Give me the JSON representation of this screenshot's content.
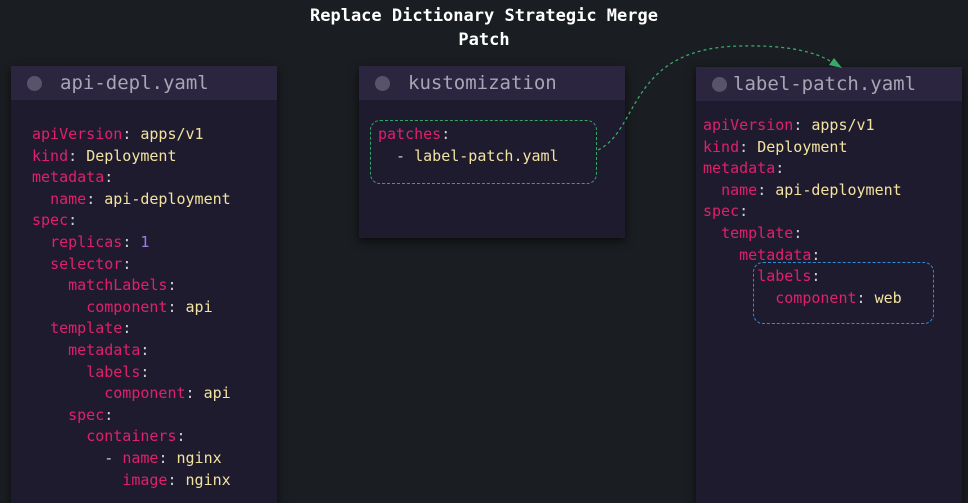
{
  "title_line1": "Replace Dictionary Strategic Merge",
  "title_line2": "Patch",
  "panels": {
    "base": {
      "name": "api-depl.yaml",
      "lines": [
        {
          "indent": "",
          "key": "apiVersion",
          "sep": ": ",
          "value": "apps/v1",
          "vtype": "str"
        },
        {
          "indent": "",
          "key": "kind",
          "sep": ": ",
          "value": "Deployment",
          "vtype": "str"
        },
        {
          "indent": "",
          "key": "metadata",
          "sep": ":",
          "value": "",
          "vtype": "str"
        },
        {
          "indent": "  ",
          "key": "name",
          "sep": ": ",
          "value": "api-deployment",
          "vtype": "str"
        },
        {
          "indent": "",
          "key": "spec",
          "sep": ":",
          "value": "",
          "vtype": "str"
        },
        {
          "indent": "  ",
          "key": "replicas",
          "sep": ": ",
          "value": "1",
          "vtype": "num"
        },
        {
          "indent": "  ",
          "key": "selector",
          "sep": ":",
          "value": "",
          "vtype": "str"
        },
        {
          "indent": "    ",
          "key": "matchLabels",
          "sep": ":",
          "value": "",
          "vtype": "str"
        },
        {
          "indent": "      ",
          "key": "component",
          "sep": ": ",
          "value": "api",
          "vtype": "str"
        },
        {
          "indent": "  ",
          "key": "template",
          "sep": ":",
          "value": "",
          "vtype": "str"
        },
        {
          "indent": "    ",
          "key": "metadata",
          "sep": ":",
          "value": "",
          "vtype": "str"
        },
        {
          "indent": "      ",
          "key": "labels",
          "sep": ":",
          "value": "",
          "vtype": "str"
        },
        {
          "indent": "        ",
          "key": "component",
          "sep": ": ",
          "value": "api",
          "vtype": "str"
        },
        {
          "indent": "    ",
          "key": "spec",
          "sep": ":",
          "value": "",
          "vtype": "str"
        },
        {
          "indent": "      ",
          "key": "containers",
          "sep": ":",
          "value": "",
          "vtype": "str"
        },
        {
          "indent": "        - ",
          "key": "name",
          "sep": ": ",
          "value": "nginx",
          "vtype": "str"
        },
        {
          "indent": "          ",
          "key": "image",
          "sep": ": ",
          "value": "nginx",
          "vtype": "str"
        }
      ]
    },
    "kustomization": {
      "name": "kustomization",
      "lines": [
        {
          "indent": "",
          "key": "patches",
          "sep": ":",
          "value": "",
          "vtype": "str"
        },
        {
          "indent": "  - ",
          "key": "",
          "sep": "",
          "value": "label-patch.yaml",
          "vtype": "str"
        }
      ]
    },
    "patch": {
      "name": "label-patch.yaml",
      "lines": [
        {
          "indent": "",
          "key": "apiVersion",
          "sep": ": ",
          "value": "apps/v1",
          "vtype": "str"
        },
        {
          "indent": "",
          "key": "kind",
          "sep": ": ",
          "value": "Deployment",
          "vtype": "str"
        },
        {
          "indent": "",
          "key": "metadata",
          "sep": ":",
          "value": "",
          "vtype": "str"
        },
        {
          "indent": "  ",
          "key": "name",
          "sep": ": ",
          "value": "api-deployment",
          "vtype": "str"
        },
        {
          "indent": "",
          "key": "spec",
          "sep": ":",
          "value": "",
          "vtype": "str"
        },
        {
          "indent": "  ",
          "key": "template",
          "sep": ":",
          "value": "",
          "vtype": "str"
        },
        {
          "indent": "    ",
          "key": "metadata",
          "sep": ":",
          "value": "",
          "vtype": "str"
        },
        {
          "indent": "      ",
          "key": "labels",
          "sep": ":",
          "value": "",
          "vtype": "str"
        },
        {
          "indent": "        ",
          "key": "component",
          "sep": ": ",
          "value": "web",
          "vtype": "str"
        }
      ]
    }
  },
  "colors": {
    "key": "#e0206c",
    "value": "#f2e3a0",
    "number": "#9d7ce8",
    "kustomization_highlight": "#2fa862",
    "patch_highlight": "#2e8fd8",
    "arrow": "#3aa86a"
  }
}
